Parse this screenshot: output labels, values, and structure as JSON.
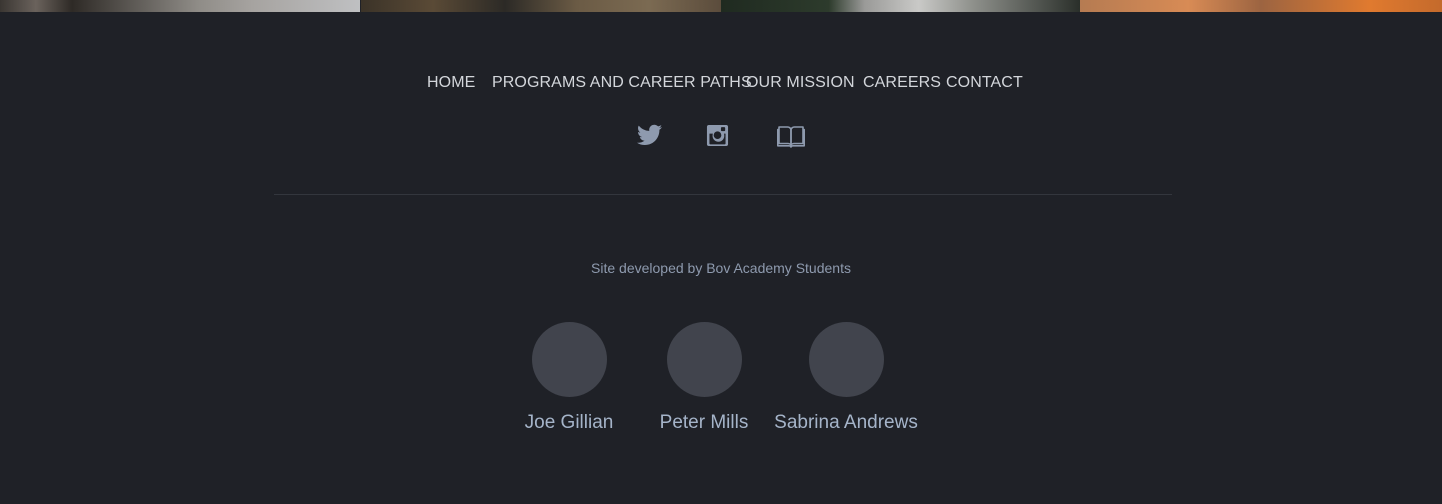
{
  "nav": {
    "items": [
      {
        "label": "HOME"
      },
      {
        "label": "PROGRAMS AND CAREER PATHS"
      },
      {
        "label": "OUR MISSION"
      },
      {
        "label": "CAREERS"
      },
      {
        "label": "CONTACT"
      }
    ]
  },
  "social": {
    "icons": [
      "twitter-icon",
      "instagram-icon",
      "book-icon"
    ],
    "icon_color": "#8e9aae"
  },
  "footer": {
    "credit": "Site developed by Bov Academy Students"
  },
  "students": [
    {
      "name": "Joe Gillian"
    },
    {
      "name": "Peter Mills"
    },
    {
      "name": "Sabrina Andrews"
    }
  ],
  "colors": {
    "background": "#1f2127",
    "nav_text": "#d3d6db",
    "muted_text": "#8e9aae",
    "name_text": "#a5b4c9",
    "avatar_placeholder": "#41444d"
  }
}
